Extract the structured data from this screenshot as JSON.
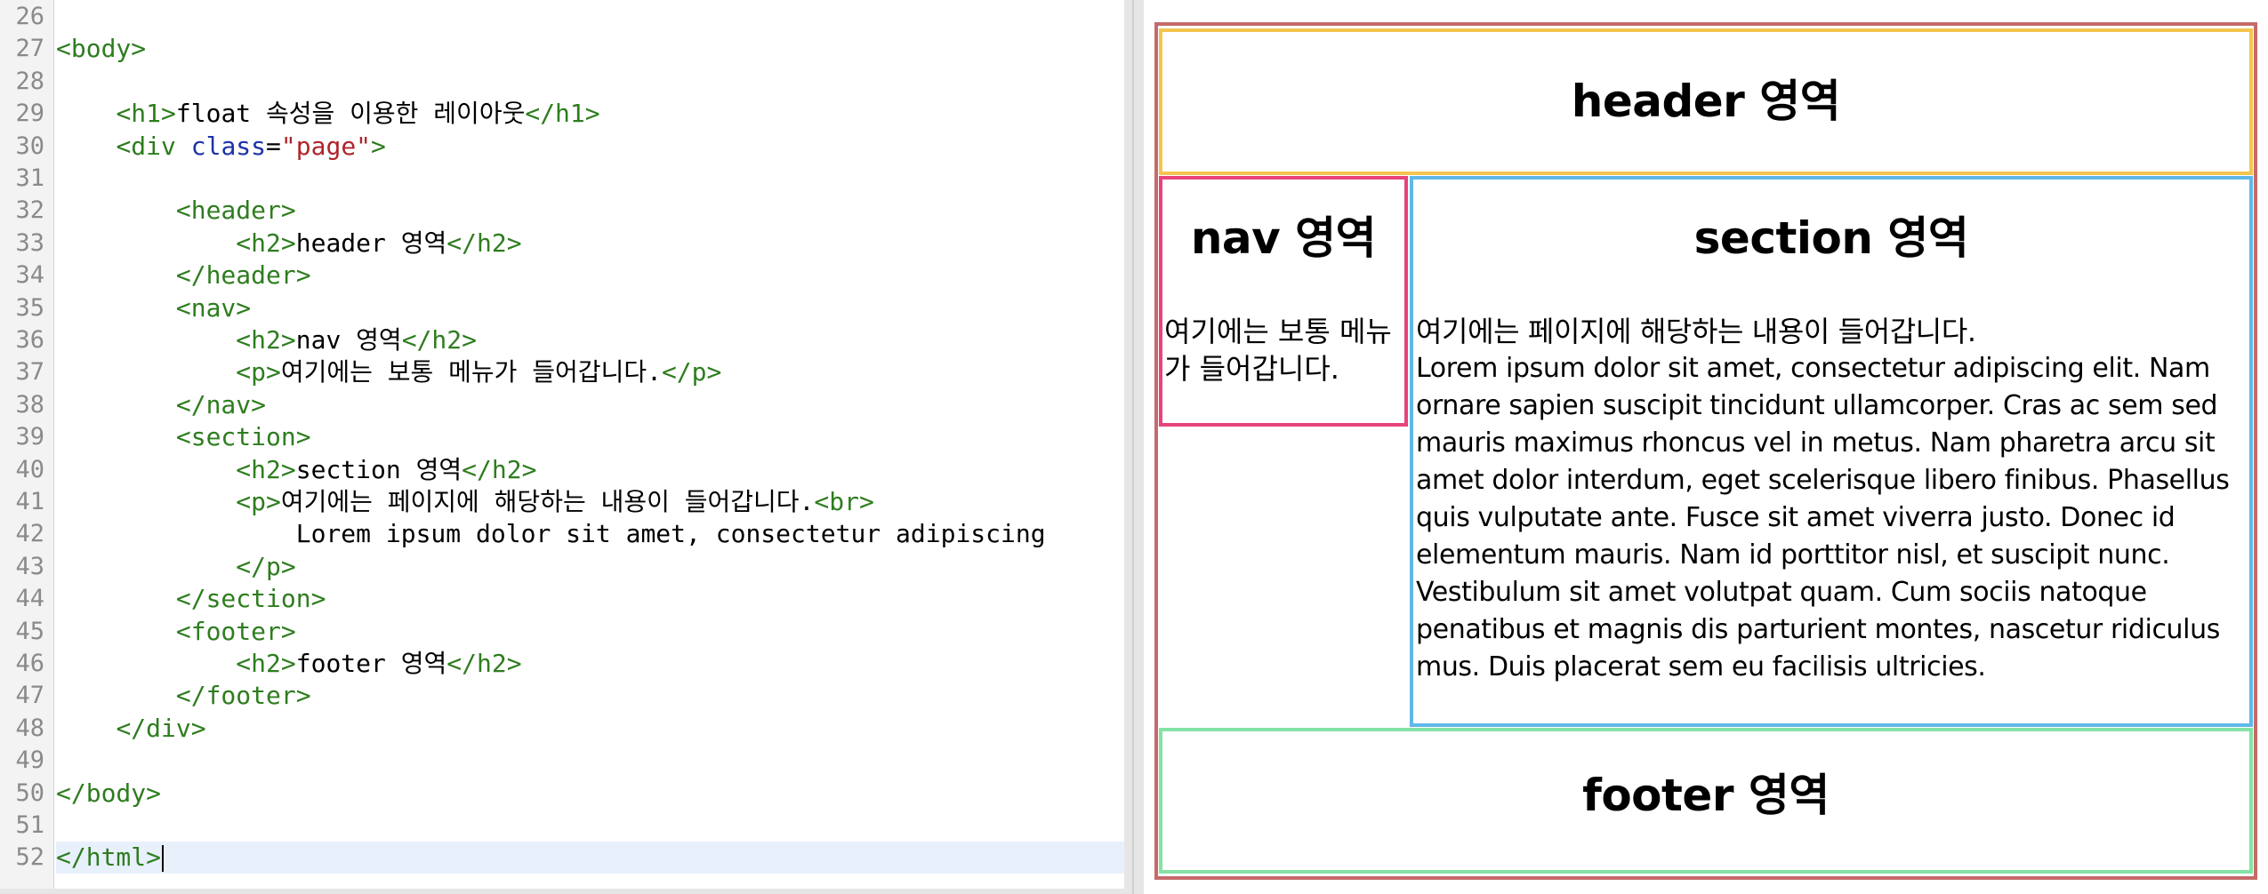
{
  "editor": {
    "lines": [
      {
        "n": "26",
        "code": ""
      },
      {
        "n": "27",
        "code": "<body>"
      },
      {
        "n": "28",
        "code": ""
      },
      {
        "n": "29",
        "code": "    <h1>float 속성을 이용한 레이아웃</h1>"
      },
      {
        "n": "30",
        "code": "    <div class=\"page\">"
      },
      {
        "n": "31",
        "code": ""
      },
      {
        "n": "32",
        "code": "        <header>"
      },
      {
        "n": "33",
        "code": "            <h2>header 영역</h2>"
      },
      {
        "n": "34",
        "code": "        </header>"
      },
      {
        "n": "35",
        "code": "        <nav>"
      },
      {
        "n": "36",
        "code": "            <h2>nav 영역</h2>"
      },
      {
        "n": "37",
        "code": "            <p>여기에는 보통 메뉴가 들어갑니다.</p>"
      },
      {
        "n": "38",
        "code": "        </nav>"
      },
      {
        "n": "39",
        "code": "        <section>"
      },
      {
        "n": "40",
        "code": "            <h2>section 영역</h2>"
      },
      {
        "n": "41",
        "code": "            <p>여기에는 페이지에 해당하는 내용이 들어갑니다.<br>"
      },
      {
        "n": "42",
        "code": "                Lorem ipsum dolor sit amet, consectetur adipiscing"
      },
      {
        "n": "43",
        "code": "            </p>"
      },
      {
        "n": "44",
        "code": "        </section>"
      },
      {
        "n": "45",
        "code": "        <footer>"
      },
      {
        "n": "46",
        "code": "            <h2>footer 영역</h2>"
      },
      {
        "n": "47",
        "code": "        </footer>"
      },
      {
        "n": "48",
        "code": "    </div>"
      },
      {
        "n": "49",
        "code": ""
      },
      {
        "n": "50",
        "code": "</body>"
      },
      {
        "n": "51",
        "code": ""
      },
      {
        "n": "52",
        "code": "</html>"
      }
    ],
    "current_line": "52"
  },
  "preview": {
    "header_title": "header 영역",
    "nav_title": "nav 영역",
    "nav_text": "여기에는 보통 메뉴가 들어갑니다.",
    "section_title": "section 영역",
    "section_text_ko": "여기에는 페이지에 해당하는 내용이 들어갑니다.",
    "section_text_lorem": "Lorem ipsum dolor sit amet, consectetur adipiscing elit. Nam ornare sapien suscipit tincidunt ullamcorper. Cras ac sem sed mauris maximus rhoncus vel in metus. Nam pharetra arcu sit amet dolor interdum, eget scelerisque libero finibus. Phasellus quis vulputate ante. Fusce sit amet viverra justo. Donec id elementum mauris. Nam id porttitor nisl, et suscipit nunc. Vestibulum sit amet volutpat quam. Cum sociis natoque penatibus et magnis dis parturient montes, nascetur ridiculus mus. Duis placerat sem eu facilisis ultricies.",
    "footer_title": "footer 영역"
  },
  "colors": {
    "page_border": "#c56a6a",
    "header_border": "#f5c451",
    "nav_border": "#e8437a",
    "section_border": "#5fb8e8",
    "footer_border": "#84e3a4",
    "tag_color": "#2e7d1f",
    "attr_color": "#1c33a8",
    "string_color": "#b0242a"
  }
}
